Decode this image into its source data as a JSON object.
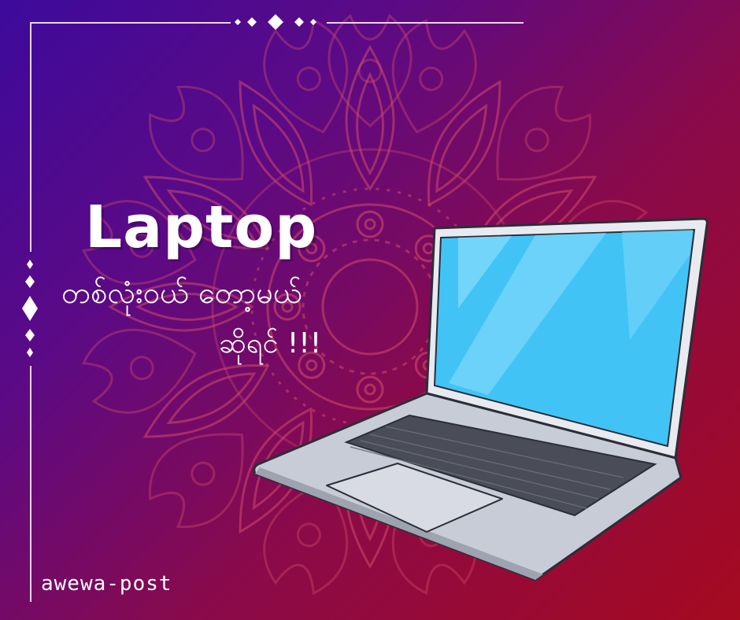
{
  "headline": "Laptop",
  "subline_1": "တစ်လုံးဝယ် တော့မယ်",
  "subline_2": "ဆိုရင် !!!",
  "footer_tag": "awewa-post",
  "colors": {
    "gradient_start": "#3d0a9c",
    "gradient_end": "#a50a20",
    "mandala": "#d04a6a",
    "screen": "#41c4f5",
    "laptop_body": "#c8ccd6",
    "keyboard": "#4a4d57",
    "text": "#ffffff"
  },
  "icons": [
    "mandala-ornament",
    "laptop-illustration",
    "diamond-ornament"
  ]
}
